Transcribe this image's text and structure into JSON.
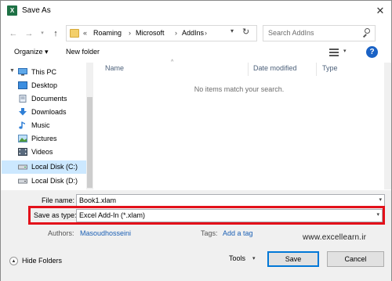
{
  "window": {
    "title": "Save As",
    "close_glyph": "✕",
    "app_icon_letter": "X"
  },
  "nav": {
    "back_icon": "arrow-left-icon",
    "forward_icon": "arrow-right-icon",
    "recent_icon": "chevron-down-icon",
    "up_icon": "arrow-up-icon",
    "path": {
      "prefix": "«",
      "parts": [
        "Roaming",
        "Microsoft",
        "AddIns"
      ],
      "separator": "›"
    },
    "search_placeholder": "Search AddIns"
  },
  "toolbar": {
    "organize": "Organize ▾",
    "new_folder": "New folder",
    "help": "?"
  },
  "tree": [
    {
      "label": "This PC",
      "icon": "computer-icon",
      "expanded": true
    },
    {
      "label": "Desktop",
      "icon": "desktop-icon"
    },
    {
      "label": "Documents",
      "icon": "documents-icon"
    },
    {
      "label": "Downloads",
      "icon": "downloads-icon"
    },
    {
      "label": "Music",
      "icon": "music-icon"
    },
    {
      "label": "Pictures",
      "icon": "pictures-icon"
    },
    {
      "label": "Videos",
      "icon": "videos-icon"
    },
    {
      "label": "Local Disk (C:)",
      "icon": "drive-icon",
      "selected": true
    },
    {
      "label": "Local Disk (D:)",
      "icon": "drive-icon"
    }
  ],
  "columns": {
    "name": "Name",
    "date_modified": "Date modified",
    "type": "Type"
  },
  "empty_message": "No items match your search.",
  "form": {
    "file_name_label": "File name:",
    "file_name_value": "Book1.xlam",
    "save_type_label": "Save as type:",
    "save_type_value": "Excel Add-In (*.xlam)",
    "authors_label": "Authors:",
    "authors_value": "Masoudhosseini",
    "tags_label": "Tags:",
    "tags_value": "Add a tag"
  },
  "watermark": "www.excellearn.ir",
  "footer": {
    "hide_folders": "Hide Folders",
    "tools": "Tools",
    "save": "Save",
    "cancel": "Cancel"
  },
  "colors": {
    "highlight": "#e3101a",
    "accent": "#0078d7",
    "link": "#1a5fb4",
    "selected": "#cce8ff"
  }
}
